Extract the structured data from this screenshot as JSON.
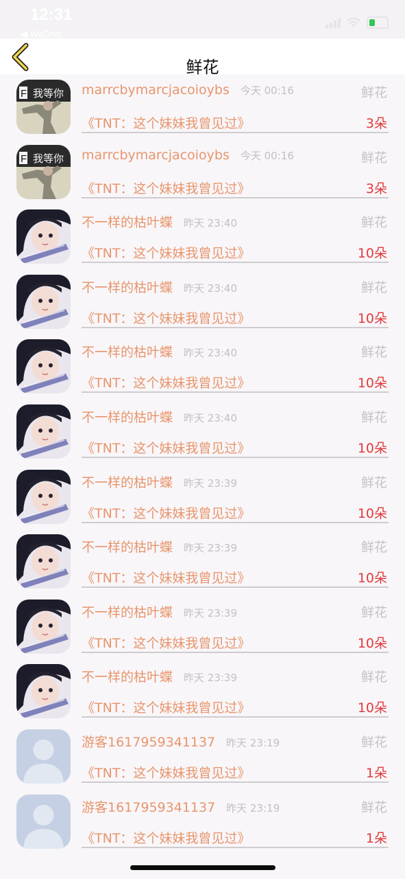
{
  "status_bar": {
    "time": "12:31",
    "sub": "◀ WeChat"
  },
  "nav": {
    "title": "鲜花",
    "back_icon": "chevron-left-icon"
  },
  "colors": {
    "name": "#e8956c",
    "count": "#e03a3a",
    "muted": "#c4bfc4",
    "accent": "#f0d54a"
  },
  "rows": [
    {
      "name": "marrcbymarcjacoioybs",
      "time": "今天 00:16",
      "gift_label": "鲜花",
      "work": "《TNT：这个妹妹我曾见过》",
      "count": "3朵",
      "avatar": "dancer"
    },
    {
      "name": "marrcbymarcjacoioybs",
      "time": "今天 00:16",
      "gift_label": "鲜花",
      "work": "《TNT：这个妹妹我曾见过》",
      "count": "3朵",
      "avatar": "dancer"
    },
    {
      "name": "不一样的枯叶蝶",
      "time": "昨天 23:40",
      "gift_label": "鲜花",
      "work": "《TNT：这个妹妹我曾见过》",
      "count": "10朵",
      "avatar": "girl"
    },
    {
      "name": "不一样的枯叶蝶",
      "time": "昨天 23:40",
      "gift_label": "鲜花",
      "work": "《TNT：这个妹妹我曾见过》",
      "count": "10朵",
      "avatar": "girl"
    },
    {
      "name": "不一样的枯叶蝶",
      "time": "昨天 23:40",
      "gift_label": "鲜花",
      "work": "《TNT：这个妹妹我曾见过》",
      "count": "10朵",
      "avatar": "girl"
    },
    {
      "name": "不一样的枯叶蝶",
      "time": "昨天 23:40",
      "gift_label": "鲜花",
      "work": "《TNT：这个妹妹我曾见过》",
      "count": "10朵",
      "avatar": "girl"
    },
    {
      "name": "不一样的枯叶蝶",
      "time": "昨天 23:39",
      "gift_label": "鲜花",
      "work": "《TNT：这个妹妹我曾见过》",
      "count": "10朵",
      "avatar": "girl"
    },
    {
      "name": "不一样的枯叶蝶",
      "time": "昨天 23:39",
      "gift_label": "鲜花",
      "work": "《TNT：这个妹妹我曾见过》",
      "count": "10朵",
      "avatar": "girl"
    },
    {
      "name": "不一样的枯叶蝶",
      "time": "昨天 23:39",
      "gift_label": "鲜花",
      "work": "《TNT：这个妹妹我曾见过》",
      "count": "10朵",
      "avatar": "girl"
    },
    {
      "name": "不一样的枯叶蝶",
      "time": "昨天 23:39",
      "gift_label": "鲜花",
      "work": "《TNT：这个妹妹我曾见过》",
      "count": "10朵",
      "avatar": "girl"
    },
    {
      "name": "游客1617959341137",
      "time": "昨天 23:19",
      "gift_label": "鲜花",
      "work": "《TNT：这个妹妹我曾见过》",
      "count": "1朵",
      "avatar": "default"
    },
    {
      "name": "游客1617959341137",
      "time": "昨天 23:19",
      "gift_label": "鲜花",
      "work": "《TNT：这个妹妹我曾见过》",
      "count": "1朵",
      "avatar": "default"
    }
  ]
}
